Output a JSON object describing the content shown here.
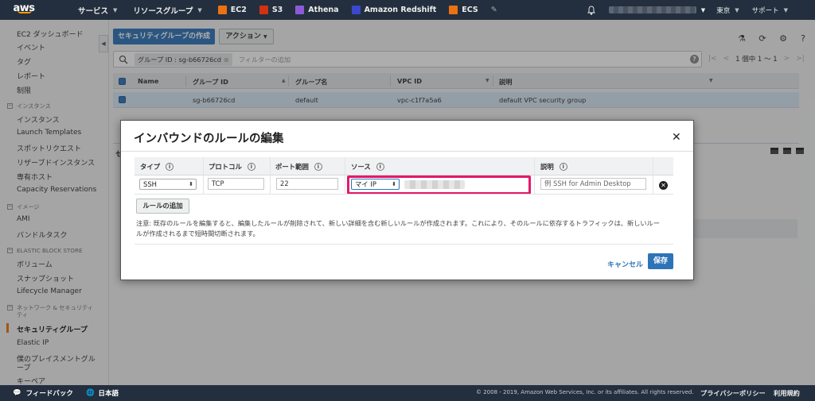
{
  "topnav": {
    "logo": "aws",
    "services": "サービス",
    "resource_groups": "リソースグループ",
    "shortcuts": [
      {
        "label": "EC2",
        "color": "#ec7211"
      },
      {
        "label": "S3",
        "color": "#d13212"
      },
      {
        "label": "Athena",
        "color": "#8a5bd6"
      },
      {
        "label": "Amazon Redshift",
        "color": "#3b48cc"
      },
      {
        "label": "ECS",
        "color": "#ec7211"
      }
    ],
    "region": "東京",
    "support": "サポート"
  },
  "sidebar": {
    "items_top": [
      "EC2 ダッシュボード",
      "イベント",
      "タグ",
      "レポート",
      "制限"
    ],
    "sections": [
      {
        "header": "インスタンス",
        "items": [
          "インスタンス",
          "Launch Templates",
          "スポットリクエスト",
          "リザーブドインスタンス",
          "専有ホスト",
          "Capacity Reservations"
        ]
      },
      {
        "header": "イメージ",
        "items": [
          "AMI",
          "バンドルタスク"
        ]
      },
      {
        "header": "ELASTIC BLOCK STORE",
        "items": [
          "ボリューム",
          "スナップショット",
          "Lifecycle Manager"
        ]
      },
      {
        "header_line1": "ネットワーク & セキュリティ",
        "header_line2": "ティ",
        "items": [
          "セキュリティグループ",
          "Elastic IP",
          "僕のプレイスメントグル",
          "ープ",
          "キーペア"
        ]
      }
    ],
    "active": "セキュリティグループ"
  },
  "toolbar": {
    "create_button": "セキュリティグループの作成",
    "actions_button": "アクション"
  },
  "filter": {
    "chip": "グループ ID : sg-b66726cd",
    "placeholder": "フィルターの追加",
    "pager": "1 個中 1 〜 1"
  },
  "table": {
    "columns": [
      "Name",
      "グループ ID",
      "グループ名",
      "VPC ID",
      "説明"
    ],
    "rows": [
      {
        "name": "",
        "group_id": "sg-b66726cd",
        "group_name": "default",
        "vpc_id": "vpc-c1f7a5a6",
        "description": "default VPC security group"
      }
    ]
  },
  "lower_panel_label": "セ",
  "modal": {
    "title": "インバウンドのルールの編集",
    "columns": [
      "タイプ",
      "プロトコル",
      "ポート範囲",
      "ソース",
      "説明"
    ],
    "rule": {
      "type": "SSH",
      "protocol": "TCP",
      "port_range": "22",
      "source": "マイ IP",
      "description": "例 SSH for Admin Desktop"
    },
    "add_rule": "ルールの追加",
    "note": "注意: 既存のルールを編集すると、編集したルールが削除されて、新しい詳細を含む新しいルールが作成されます。これにより、そのルールに依存するトラフィックは、新しいルールが作成されるまで短時間切断されます。",
    "cancel": "キャンセル",
    "save": "保存",
    "highlight_color": "#e3196b"
  },
  "footer": {
    "feedback": "フィードバック",
    "language": "日本語",
    "copyright": "© 2008 - 2019, Amazon Web Services, Inc. or its affiliates. All rights reserved.",
    "privacy": "プライバシーポリシー",
    "terms": "利用規約"
  }
}
